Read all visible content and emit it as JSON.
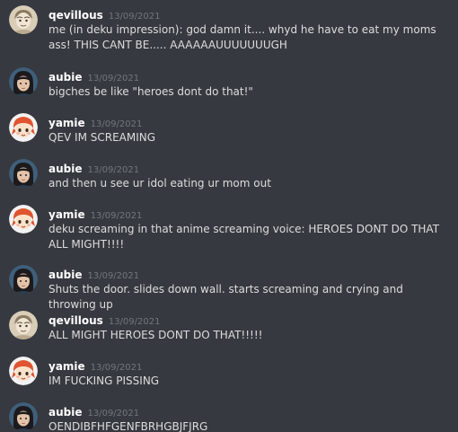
{
  "messages": [
    {
      "author": "qevillous",
      "avatar": "qevillous-avatar-icon",
      "time": "13/09/2021",
      "text": "me (in deku impression): god damn it.... whyd he have to eat my moms ass! THIS CANT BE..... AAAAAAUUUUUUUGH"
    },
    {
      "author": "aubie",
      "avatar": "aubie-avatar-icon",
      "time": "13/09/2021",
      "text": "bigches be like \"heroes dont do that!\""
    },
    {
      "author": "yamie",
      "avatar": "yamie-avatar-icon",
      "time": "13/09/2021",
      "text": "QEV IM SCREAMING"
    },
    {
      "author": "aubie",
      "avatar": "aubie-avatar-icon",
      "time": "13/09/2021",
      "text": "and then u see ur idol eating ur mom out"
    },
    {
      "author": "yamie",
      "avatar": "yamie-avatar-icon",
      "time": "13/09/2021",
      "text": "deku screaming in that anime screaming voice: HEROES DONT DO THAT ALL MIGHT!!!!"
    },
    {
      "author": "aubie",
      "avatar": "aubie-avatar-icon",
      "time": "13/09/2021",
      "text": "Shuts the door. slides down wall. starts screaming and crying and throwing up"
    },
    {
      "author": "qevillous",
      "avatar": "qevillous-avatar-icon",
      "time": "13/09/2021",
      "text": "ALL MIGHT HEROES DONT DO THAT!!!!!"
    },
    {
      "author": "yamie",
      "avatar": "yamie-avatar-icon",
      "time": "13/09/2021",
      "text": "IM FUCKING PISSING"
    },
    {
      "author": "aubie",
      "avatar": "aubie-avatar-icon",
      "time": "13/09/2021",
      "text": "OENDIBFHFGENFBRHGBJFJRG"
    }
  ],
  "colors": {
    "background": "#36393f",
    "username": "#ffffff",
    "timestamp": "#72767d",
    "message_text": "#dcddde"
  }
}
